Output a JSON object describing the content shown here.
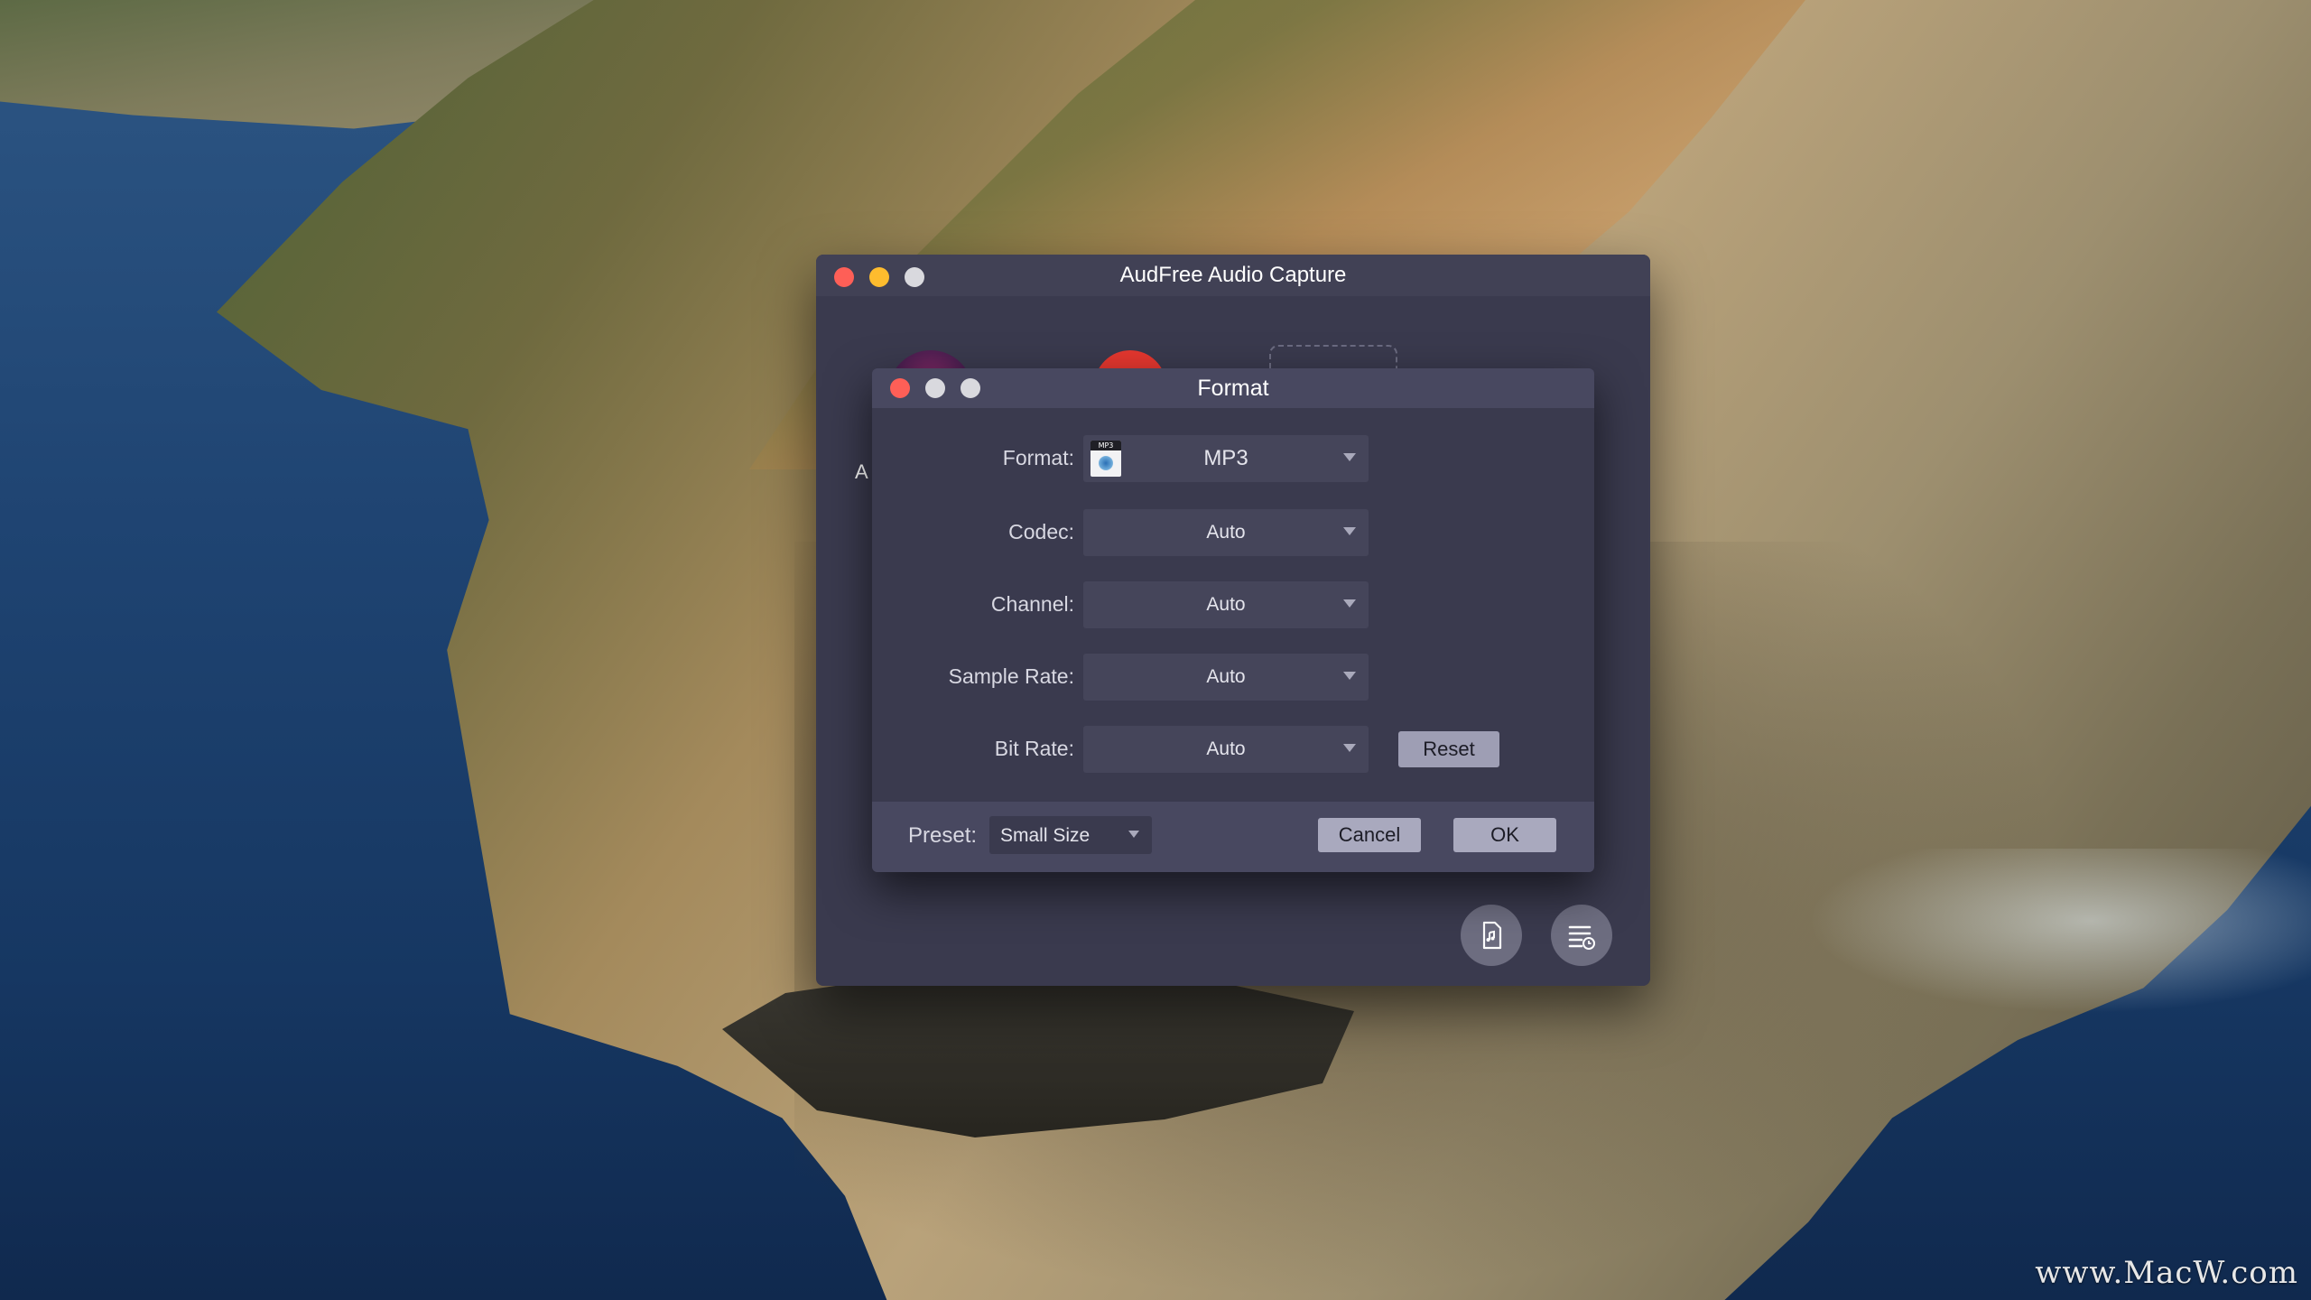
{
  "app_window": {
    "title": "AudFree Audio Capture",
    "partial_label": "A"
  },
  "format_dialog": {
    "title": "Format",
    "rows": [
      {
        "label": "Format:",
        "value": "MP3"
      },
      {
        "label": "Codec:",
        "value": "Auto"
      },
      {
        "label": "Channel:",
        "value": "Auto"
      },
      {
        "label": "Sample Rate:",
        "value": "Auto"
      },
      {
        "label": "Bit Rate:",
        "value": "Auto"
      }
    ],
    "format_icon_text": "MP3",
    "reset_label": "Reset",
    "preset_label": "Preset:",
    "preset_value": "Small Size",
    "cancel_label": "Cancel",
    "ok_label": "OK"
  },
  "watermark": "www.MacW.com",
  "colors": {
    "close": "#fe5f57",
    "minimize": "#febc2e",
    "window_bg": "#3a3a4e",
    "button_bg": "#a9a9be"
  },
  "icons": {
    "bottom_left": "audio-file-icon",
    "bottom_right": "history-list-icon"
  }
}
